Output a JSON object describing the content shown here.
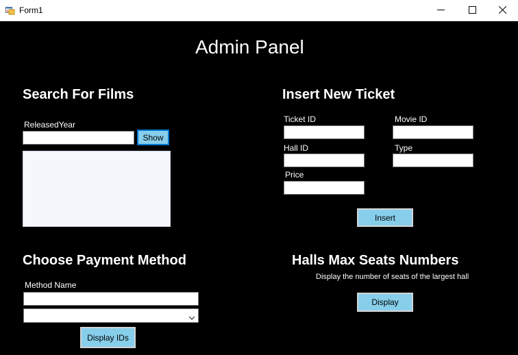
{
  "window": {
    "title": "Form1"
  },
  "page": {
    "title": "Admin Panel"
  },
  "search_films": {
    "heading": "Search For Films",
    "released_year_label": "ReleasedYear",
    "released_year_value": "",
    "show_button": "Show"
  },
  "insert_ticket": {
    "heading": "Insert New Ticket",
    "ticket_id_label": "Ticket ID",
    "movie_id_label": "Movie ID",
    "hall_id_label": "Hall ID",
    "type_label": "Type",
    "price_label": "Price",
    "ticket_id_value": "",
    "movie_id_value": "",
    "hall_id_value": "",
    "type_value": "",
    "price_value": "",
    "insert_button": "Insert"
  },
  "payment": {
    "heading": "Choose Payment Method",
    "method_name_label": "Method Name",
    "method_name_value": "",
    "selected_value": "",
    "display_ids_button": "Display IDs"
  },
  "halls": {
    "heading": "Halls Max Seats Numbers",
    "description": "Display the number of seats of the largest hall",
    "display_button": "Display"
  },
  "colors": {
    "background": "#000000",
    "button": "#87ceeb",
    "text": "#ffffff"
  },
  "icons": [
    "app-form-icon",
    "minimize-icon",
    "maximize-icon",
    "close-icon",
    "chevron-down-icon"
  ]
}
